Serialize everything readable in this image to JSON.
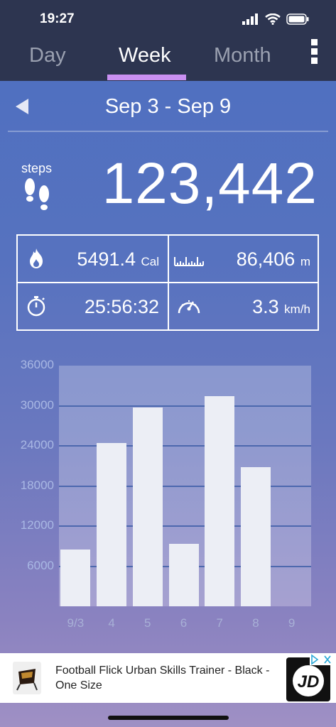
{
  "status_bar": {
    "time": "19:27"
  },
  "tabs": [
    {
      "label": "Day",
      "active": false
    },
    {
      "label": "Week",
      "active": true
    },
    {
      "label": "Month",
      "active": false
    }
  ],
  "nav": {
    "range": "Sep 3 - Sep 9"
  },
  "steps": {
    "label": "steps",
    "value": "123,442"
  },
  "stats": {
    "calories": {
      "value": "5491.4",
      "unit": "Cal"
    },
    "distance": {
      "value": "86,406",
      "unit": "m"
    },
    "duration": {
      "value": "25:56:32"
    },
    "speed": {
      "value": "3.3",
      "unit": "km/h"
    }
  },
  "chart_data": {
    "type": "bar",
    "categories": [
      "9/3",
      "4",
      "5",
      "6",
      "7",
      "8",
      "9"
    ],
    "values": [
      8500,
      24400,
      29700,
      9300,
      31400,
      20800,
      0
    ],
    "ylim": [
      0,
      36000
    ],
    "yticks": [
      "6000",
      "12000",
      "18000",
      "24000",
      "30000",
      "36000"
    ],
    "grid": true
  },
  "ad": {
    "text": "Football Flick Urban Skills Trainer - Black - One Size",
    "logo_text": "JD"
  }
}
